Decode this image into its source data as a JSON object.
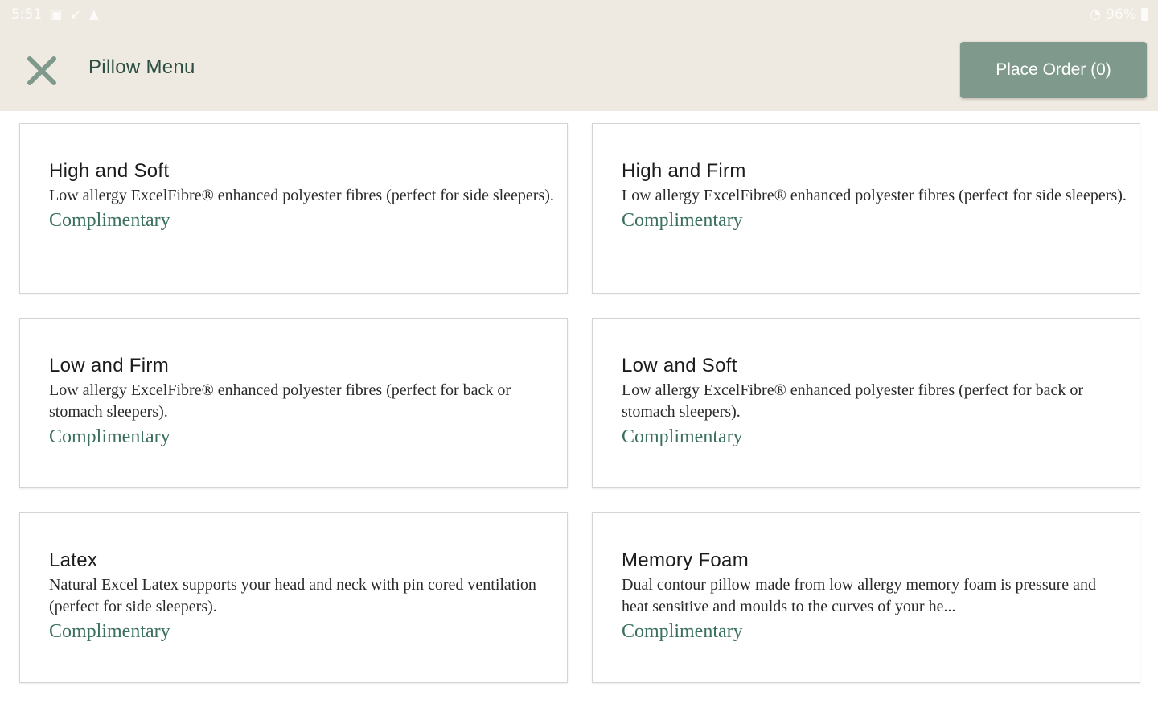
{
  "status_bar": {
    "time": "5:51",
    "battery_percent": "96%",
    "icons": [
      "image-icon",
      "missed-call-icon",
      "warning-icon",
      "wifi-icon",
      "battery-icon"
    ]
  },
  "header": {
    "title": "Pillow Menu",
    "close_icon": "close-icon",
    "place_order_label": "Place Order (0)"
  },
  "colors": {
    "header_bg": "#efeae1",
    "accent": "#7f9a8c",
    "title_green": "#2e4f43",
    "price_green": "#3b7060"
  },
  "pillows": [
    {
      "name": "High and Soft",
      "description": "Low allergy ExcelFibre® enhanced polyester fibres (perfect for side sleepers).",
      "price": "Complimentary"
    },
    {
      "name": "High and Firm",
      "description": "Low allergy ExcelFibre® enhanced polyester fibres (perfect for side sleepers).",
      "price": "Complimentary"
    },
    {
      "name": "Low and Firm",
      "description": "Low allergy ExcelFibre® enhanced polyester fibres (perfect for back or stomach sleepers).",
      "price": "Complimentary"
    },
    {
      "name": "Low and Soft",
      "description": "Low allergy ExcelFibre® enhanced polyester fibres (perfect for back or stomach sleepers).",
      "price": "Complimentary"
    },
    {
      "name": "Latex",
      "description": "Natural Excel Latex supports your head and neck with pin cored ventilation (perfect for side sleepers).",
      "price": "Complimentary"
    },
    {
      "name": "Memory Foam",
      "description": "Dual contour pillow made from low allergy memory foam is pressure and heat sensitive and moulds to the curves of your he...",
      "price": "Complimentary"
    }
  ]
}
